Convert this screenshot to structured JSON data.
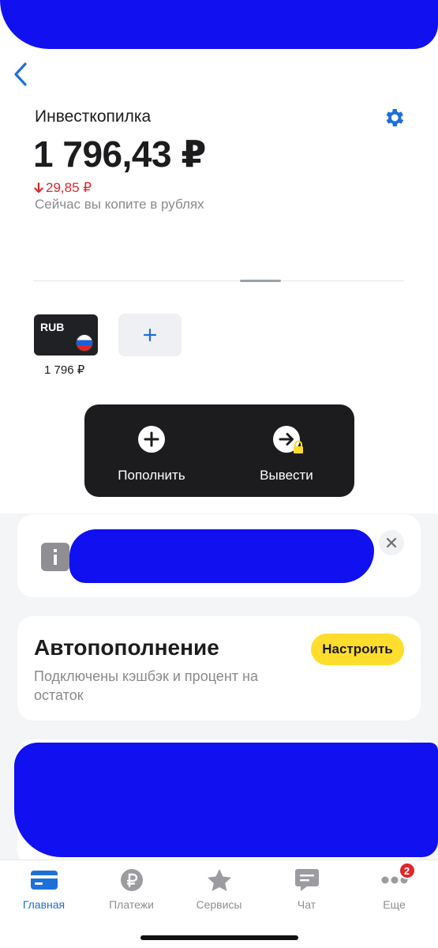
{
  "header": {
    "title": "Инвесткопилка",
    "balance": "1 796,43 ₽",
    "change": "29,85 ₽",
    "subtitle": "Сейчас вы копите в рублях"
  },
  "currency_cards": [
    {
      "code": "RUB",
      "amount": "1 796 ₽"
    }
  ],
  "add_card_label": "+",
  "actions": {
    "deposit": "Пополнить",
    "withdraw": "Вывести"
  },
  "autofill": {
    "title": "Автопополнение",
    "description": "Подключены кэшбэк и процент на остаток",
    "button": "Настроить"
  },
  "tabs": [
    {
      "label": "Главная",
      "icon": "card-icon"
    },
    {
      "label": "Платежи",
      "icon": "ruble-icon"
    },
    {
      "label": "Сервисы",
      "icon": "star-icon"
    },
    {
      "label": "Чат",
      "icon": "chat-icon"
    },
    {
      "label": "Еще",
      "icon": "more-icon",
      "badge": "2"
    }
  ],
  "colors": {
    "accent": "#1f6fd8",
    "negative": "#e0262b",
    "button_yellow": "#ffdd2d",
    "dark_panel": "#1c1c1e"
  }
}
